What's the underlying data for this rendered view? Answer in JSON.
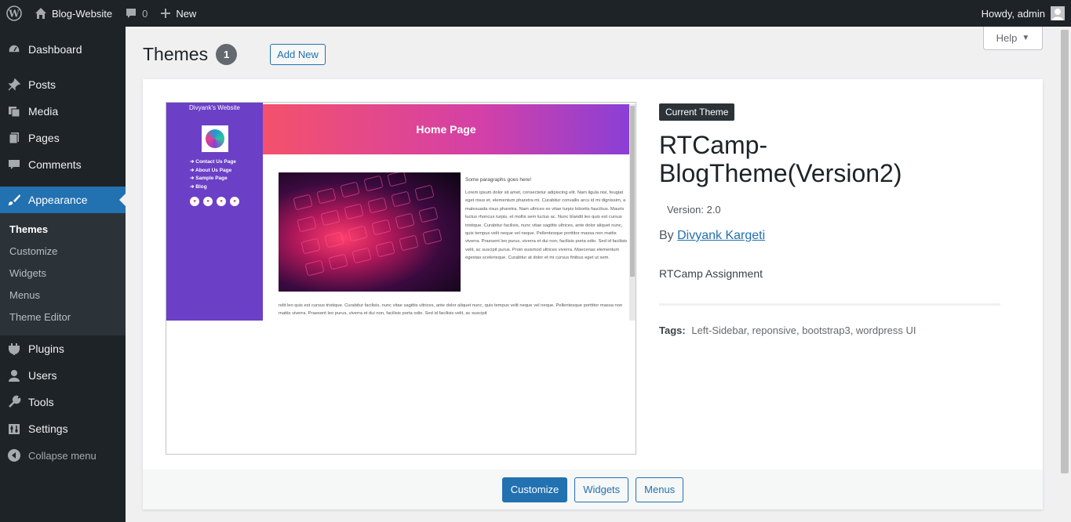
{
  "adminbar": {
    "site_name": "Blog-Website",
    "comments_count": "0",
    "new_label": "New",
    "howdy": "Howdy, admin"
  },
  "sidebar": {
    "items": [
      {
        "label": "Dashboard",
        "icon": "dashboard-icon"
      },
      {
        "label": "Posts",
        "icon": "pin-icon"
      },
      {
        "label": "Media",
        "icon": "media-icon"
      },
      {
        "label": "Pages",
        "icon": "pages-icon"
      },
      {
        "label": "Comments",
        "icon": "comment-icon"
      },
      {
        "label": "Appearance",
        "icon": "brush-icon"
      },
      {
        "label": "Plugins",
        "icon": "plugin-icon"
      },
      {
        "label": "Users",
        "icon": "user-icon"
      },
      {
        "label": "Tools",
        "icon": "wrench-icon"
      },
      {
        "label": "Settings",
        "icon": "settings-icon"
      }
    ],
    "submenu": [
      "Themes",
      "Customize",
      "Widgets",
      "Menus",
      "Theme Editor"
    ],
    "collapse_label": "Collapse menu"
  },
  "page": {
    "title": "Themes",
    "count": "1",
    "add_new": "Add New",
    "help": "Help"
  },
  "screenshot": {
    "site_title": "Divyank's Website",
    "links": [
      "Contact Us Page",
      "About Us Page",
      "Sample Page",
      "Blog"
    ],
    "hero": "Home Page",
    "para_title": "Some paragraphs goes here!",
    "para": "Lorem ipsum dolor sit amet, consectetur adipiscing elit. Nam ligula nisi, feugiat eget risus et, elementum pharetra mi. Curabitur convallis arcu id mi dignissim, a malesuada risus pharetra. Nam ultrices ex vitae turpis lobortis faucibus. Mauris luctus rhoncus turpis, et mollis sem luctus ac. Nunc blandit leo quis est cursus tristique. Curabitur facilisis, nunc vitae sagittis ultrices, ante dolor aliquet nunc, quis tempus velit neque vel neque. Pellentesque porttitor massa non mattis viverra. Praesent leo purus, viverra et dui non, facilisis porta odio. Sed id facilisis velit, ac suscipit purus. Proin euismod ultrices viverra. Maecenas elementum egestas scelerisque. Curabitur at dolor et mi cursus finibus eget ut sem.",
    "para2": "ndit leo quis est cursus tristique. Curabitur facilisis, nunc vitae sagittis ultrices, ante dolor aliquet nunc, quis tempus velit neque vel neque. Pellentesque porttitor massa non mattis viverra. Praesent leo purus, viverra et dui non, facilisis porta odio. Sed id facilisis velit, ac suscipit"
  },
  "theme": {
    "badge": "Current Theme",
    "name": "RTCamp-BlogTheme(Version2)",
    "version": "Version: 2.0",
    "by": "By",
    "author": "Divyank Kargeti",
    "description": "RTCamp Assignment",
    "tags_label": "Tags:",
    "tags": "Left-Sidebar, reponsive, bootstrap3, wordpress UI"
  },
  "actions": {
    "customize": "Customize",
    "widgets": "Widgets",
    "menus": "Menus"
  },
  "colors": {
    "accent": "#2271b1",
    "adminbar_bg": "#1d2327",
    "theme_sidebar": "#6b3fc6"
  }
}
